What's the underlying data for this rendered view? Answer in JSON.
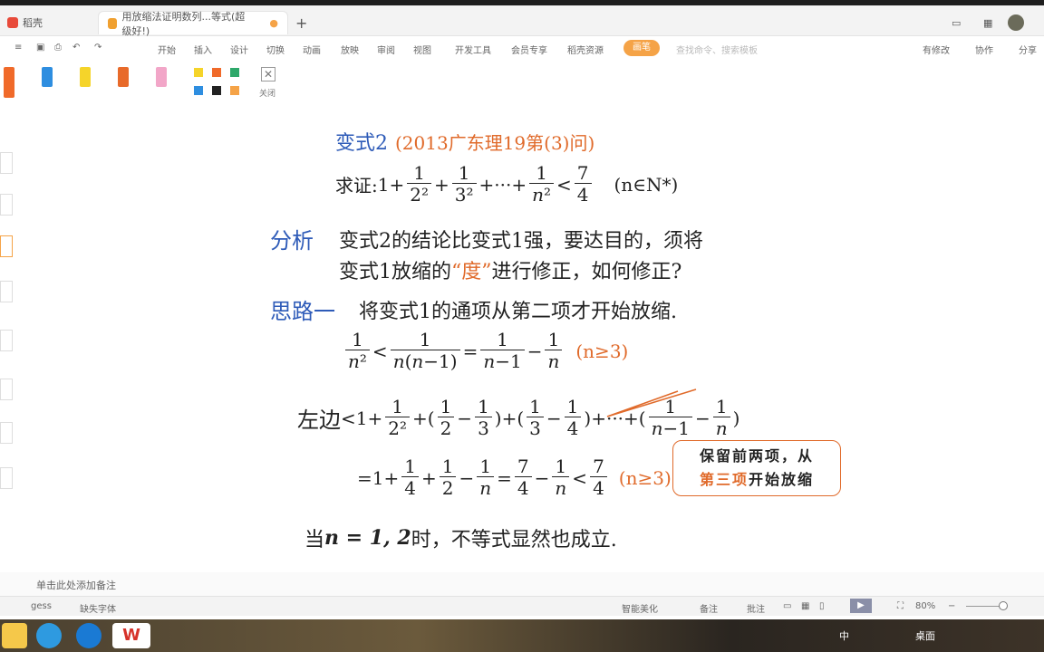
{
  "app": {
    "name": "稻壳"
  },
  "tabs": [
    {
      "label": "稻壳"
    },
    {
      "label": "用放缩法证明数列...等式(超级好!)"
    }
  ],
  "menu": [
    "开始",
    "插入",
    "设计",
    "切换",
    "动画",
    "放映",
    "审阅",
    "视图",
    "开发工具",
    "会员专享",
    "稻壳资源"
  ],
  "menu_active": "画笔",
  "menu_search": "查找命令、搜索模板",
  "menu_right": [
    "有修改",
    "协作",
    "分享"
  ],
  "pen_colors": [
    "#f06a2a",
    "#2e8ee0",
    "#f5d42a",
    "#e86a2a",
    "#f2a6c8"
  ],
  "swatches": [
    "#f5d42a",
    "#f06a2a",
    "#2ea86a",
    "#2e8ee0",
    "#222222",
    "#f5a347"
  ],
  "pen_close_label": "关闭",
  "slide": {
    "heading_blue": "变式2",
    "heading_orange": "(2013广东理19第(3)问)",
    "prove_label": "求证:",
    "prove_tail": "(n∈N*)",
    "analysis_label": "分析",
    "analysis_line1": "变式2的结论比变式1强，要达目的，须将",
    "analysis_line2a": "变式1放缩的",
    "analysis_quote": "“度”",
    "analysis_line2b": "进行修正，如何修正?",
    "idea_label": "思路一",
    "idea_text": "将变式1的通项从第二项才开始放缩.",
    "cond_n3": "(n≥3)",
    "callout_line1": "保留前两项，从",
    "callout_line2a": "第三项",
    "callout_line2b": "开始放缩",
    "left_label": "左边",
    "conclusion_a": "当",
    "conclusion_b": "n = 1, 2",
    "conclusion_c": "时，不等式显然也成立."
  },
  "notes_placeholder": "单击此处添加备注",
  "status": {
    "left": "gess",
    "font_missing": "缺失字体",
    "smart_beautify": "智能美化",
    "notes": "备注",
    "comment": "批注",
    "zoom": "80%"
  },
  "tray": {
    "desktop": "桌面"
  }
}
